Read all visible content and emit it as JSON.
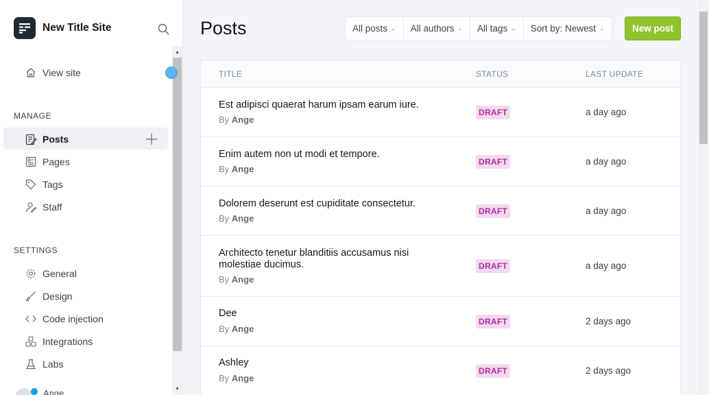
{
  "sidebar": {
    "site_name": "New Title Site",
    "view_site": "View site",
    "manage_title": "MANAGE",
    "manage_items": [
      {
        "label": "Posts",
        "icon": "posts-icon"
      },
      {
        "label": "Pages",
        "icon": "pages-icon"
      },
      {
        "label": "Tags",
        "icon": "tag-icon"
      },
      {
        "label": "Staff",
        "icon": "staff-icon"
      }
    ],
    "settings_title": "SETTINGS",
    "settings_items": [
      {
        "label": "General",
        "icon": "gear-icon"
      },
      {
        "label": "Design",
        "icon": "brush-icon"
      },
      {
        "label": "Code injection",
        "icon": "code-icon"
      },
      {
        "label": "Integrations",
        "icon": "integrations-icon"
      },
      {
        "label": "Labs",
        "icon": "flask-icon"
      }
    ],
    "user_name": "Ange"
  },
  "header": {
    "title": "Posts",
    "filters": [
      "All posts",
      "All authors",
      "All tags",
      "Sort by: Newest"
    ],
    "new_post": "New post"
  },
  "table": {
    "columns": [
      "TITLE",
      "STATUS",
      "LAST UPDATE"
    ],
    "by_prefix": "By",
    "rows": [
      {
        "title": "Est adipisci quaerat harum ipsam earum iure.",
        "author": "Ange",
        "status": "DRAFT",
        "updated": "a day ago"
      },
      {
        "title": "Enim autem non ut modi et tempore.",
        "author": "Ange",
        "status": "DRAFT",
        "updated": "a day ago"
      },
      {
        "title": "Dolorem deserunt est cupiditate consectetur.",
        "author": "Ange",
        "status": "DRAFT",
        "updated": "a day ago"
      },
      {
        "title": "Architecto tenetur blanditiis accusamus nisi molestiae ducimus.",
        "author": "Ange",
        "status": "DRAFT",
        "updated": "a day ago"
      },
      {
        "title": "Dee",
        "author": "Ange",
        "status": "DRAFT",
        "updated": "2 days ago"
      },
      {
        "title": "Ashley",
        "author": "Ange",
        "status": "DRAFT",
        "updated": "2 days ago"
      }
    ]
  },
  "colors": {
    "accent_green": "#8fc42e",
    "draft_badge_bg": "#f3d9ee",
    "draft_badge_text": "#b52aa1"
  }
}
